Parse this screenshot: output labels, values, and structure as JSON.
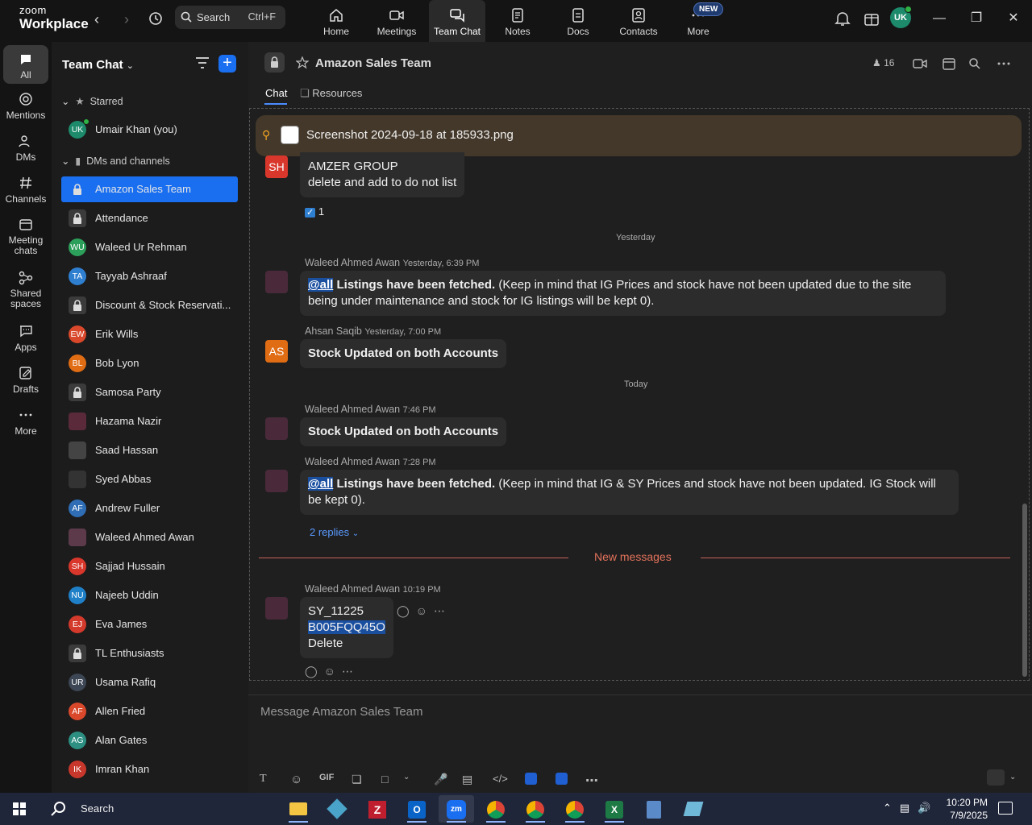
{
  "app": {
    "brand_small": "zoom",
    "brand_big": "Workplace"
  },
  "search": {
    "label": "Search",
    "shortcut": "Ctrl+F"
  },
  "topnav": [
    {
      "label": "Home"
    },
    {
      "label": "Meetings"
    },
    {
      "label": "Team Chat"
    },
    {
      "label": "Notes"
    },
    {
      "label": "Docs"
    },
    {
      "label": "Contacts"
    },
    {
      "label": "More"
    }
  ],
  "new_badge": "NEW",
  "user_initials": "UK",
  "rail": [
    {
      "label": "All"
    },
    {
      "label": "Mentions"
    },
    {
      "label": "DMs"
    },
    {
      "label": "Channels"
    },
    {
      "label": "Meeting chats"
    },
    {
      "label": "Shared spaces"
    },
    {
      "label": "Apps"
    },
    {
      "label": "Drafts"
    },
    {
      "label": "More"
    }
  ],
  "sidebar": {
    "title": "Team Chat",
    "starred": "Starred",
    "dms": "DMs and channels",
    "starred_items": [
      {
        "initials": "UK",
        "name": "Umair Khan (you)",
        "color": "#1d8a6b"
      }
    ],
    "items": [
      {
        "initials": "",
        "name": "Amazon Sales Team",
        "color": "",
        "lock": true
      },
      {
        "initials": "",
        "name": "Attendance",
        "color": "#3b3b3b",
        "lock": true
      },
      {
        "initials": "WU",
        "name": "Waleed Ur Rehman",
        "color": "#2c9f5a"
      },
      {
        "initials": "TA",
        "name": "Tayyab Ashraaf",
        "color": "#2f7fd1"
      },
      {
        "initials": "",
        "name": "Discount & Stock Reservati...",
        "color": "#3b3b3b",
        "lock": true
      },
      {
        "initials": "EW",
        "name": "Erik Wills",
        "color": "#d9482b"
      },
      {
        "initials": "BL",
        "name": "Bob Lyon",
        "color": "#e06c14"
      },
      {
        "initials": "",
        "name": "Samosa Party",
        "color": "#3b3b3b",
        "lock": true
      },
      {
        "initials": "",
        "name": "Hazama Nazir",
        "color": "#5a2a3a"
      },
      {
        "initials": "",
        "name": "Saad Hassan",
        "color": "#444"
      },
      {
        "initials": "",
        "name": "Syed Abbas",
        "color": "#333"
      },
      {
        "initials": "AF",
        "name": "Andrew Fuller",
        "color": "#2f6db5"
      },
      {
        "initials": "",
        "name": "Waleed Ahmed Awan",
        "color": "#5c3a4a"
      },
      {
        "initials": "SH",
        "name": "Sajjad Hussain",
        "color": "#d9372b"
      },
      {
        "initials": "NU",
        "name": "Najeeb Uddin",
        "color": "#1f80c8"
      },
      {
        "initials": "EJ",
        "name": "Eva James",
        "color": "#d33a2c"
      },
      {
        "initials": "",
        "name": "TL Enthusiasts",
        "color": "#3b3b3b",
        "lock": true
      },
      {
        "initials": "UR",
        "name": "Usama Rafiq",
        "color": "#3c4654"
      },
      {
        "initials": "AF",
        "name": "Allen Fried",
        "color": "#d9482b"
      },
      {
        "initials": "AG",
        "name": "Alan Gates",
        "color": "#2c8f82"
      },
      {
        "initials": "IK",
        "name": "Imran Khan",
        "color": "#c8372b"
      }
    ]
  },
  "channel": {
    "title": "Amazon Sales Team",
    "members": "16",
    "tabs": [
      "Chat",
      "Resources"
    ]
  },
  "pinned": {
    "file": "Screenshot 2024-09-18 at 185933.png"
  },
  "messages": {
    "m0": {
      "avatar": "SH",
      "line1": "AMZER GROUP",
      "line2": "delete and add to do not list",
      "reaction": "1"
    },
    "sep_yesterday": "Yesterday",
    "m1": {
      "sender": "Waleed Ahmed Awan",
      "time": "Yesterday, 6:39 PM",
      "mention": "@all",
      "bold": "Listings have been fetched.",
      "rest": " (Keep in mind that IG Prices and stock have not been updated due to the site being under maintenance and stock for IG listings will be kept 0)."
    },
    "m2": {
      "sender": "Ahsan Saqib",
      "time": "Yesterday, 7:00 PM",
      "avatar": "AS",
      "text": "Stock Updated on both Accounts"
    },
    "sep_today": "Today",
    "m3": {
      "sender": "Waleed Ahmed Awan",
      "time": "7:46 PM",
      "text": "Stock Updated on both Accounts"
    },
    "m4": {
      "sender": "Waleed Ahmed Awan",
      "time": "7:28 PM",
      "mention": "@all",
      "bold": "Listings have been fetched.",
      "rest": " (Keep in mind that IG & SY Prices and stock have not been updated. IG Stock will be kept 0).",
      "replies": "2 replies"
    },
    "new_messages": "New messages",
    "m5": {
      "sender": "Waleed Ahmed Awan",
      "time": "10:19 PM",
      "line1": "SY_11225",
      "line2": "B005FQQ45O",
      "line3": "Delete"
    }
  },
  "composer": {
    "placeholder": "Message Amazon Sales Team"
  },
  "taskbar": {
    "search": "Search",
    "time": "10:20 PM",
    "date": "7/9/2025"
  }
}
